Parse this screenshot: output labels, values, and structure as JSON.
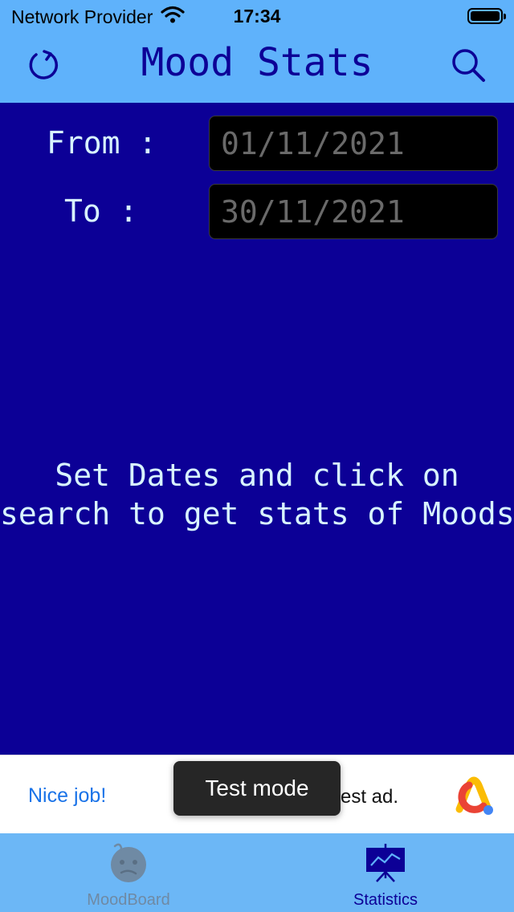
{
  "status_bar": {
    "carrier": "Network Provider",
    "time": "17:34"
  },
  "nav": {
    "title": "Mood Stats",
    "left_icon": "refresh-icon",
    "right_icon": "search-icon"
  },
  "form": {
    "from_label": "From :",
    "from_value": "01/11/2021",
    "to_label": "To :",
    "to_value": "30/11/2021"
  },
  "hint": {
    "line1": "Set Dates and click on",
    "line2": "search to get stats of Moods"
  },
  "ad": {
    "nice_text": "Nice job!",
    "ad_text": "est ad.",
    "toast": "Test mode",
    "logo_icon": "ad-logo-icon"
  },
  "tabs": [
    {
      "label": "MoodBoard",
      "icon": "confused-face-icon",
      "selected": false
    },
    {
      "label": "Statistics",
      "icon": "chart-board-icon",
      "selected": true
    }
  ],
  "colors": {
    "background": "#0c0096",
    "header": "#5fb2fb",
    "accent": "#0c0096",
    "text_light": "#d8f4ff",
    "tab_bar": "#6cb7f6",
    "ad_link": "#1a73e8"
  }
}
